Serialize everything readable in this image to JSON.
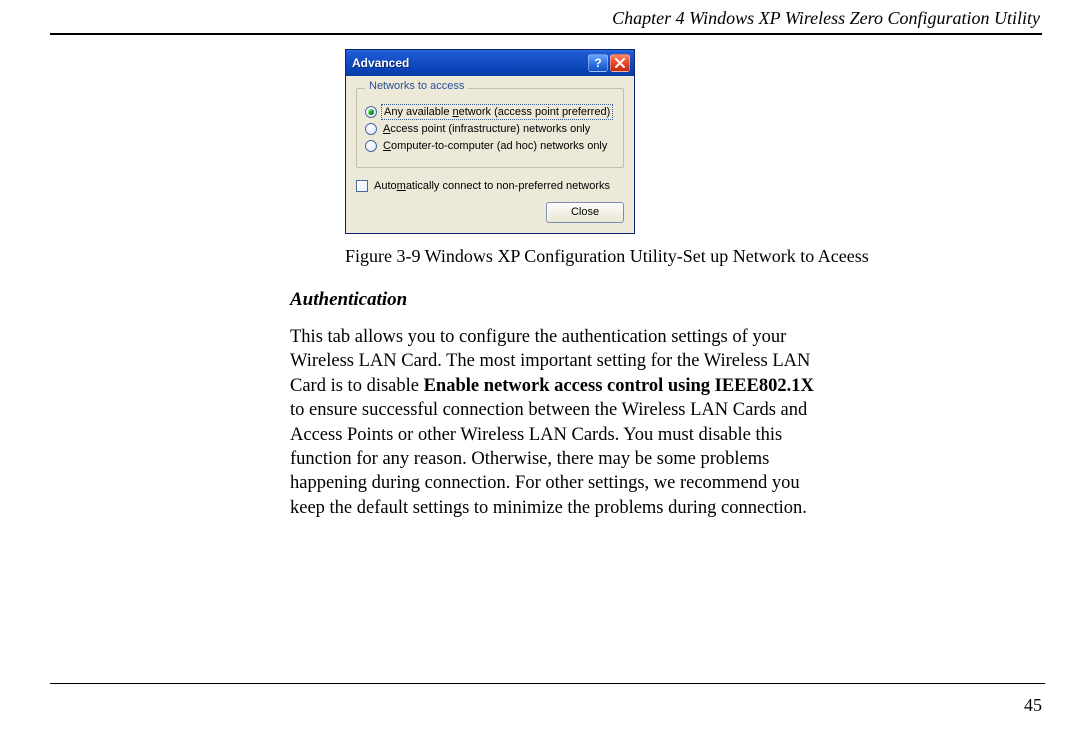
{
  "header": {
    "running_head": "Chapter 4   Windows XP Wireless Zero Configuration Utility"
  },
  "dialog": {
    "title": "Advanced",
    "group_label": "Networks to access",
    "options": {
      "any": {
        "pre": "Any available ",
        "key": "n",
        "post": "etwork (access point preferred)"
      },
      "ap": {
        "pre": "",
        "key": "A",
        "post": "ccess point (infrastructure) networks only"
      },
      "adhoc": {
        "pre": "",
        "key": "C",
        "post": "omputer-to-computer (ad hoc) networks only"
      }
    },
    "auto_connect": {
      "pre": "Auto",
      "key": "m",
      "post": "atically connect to non-preferred networks"
    },
    "close_label": "Close"
  },
  "caption": "Figure 3-9   Windows XP Configuration Utility-Set up Network to Aceess",
  "section_heading": "Authentication",
  "para_1a": "This tab allows you to configure the authentication settings of your Wireless LAN Card. The most important setting for the Wireless LAN Card is to disable ",
  "para_1_bold": "Enable network access control using IEEE802.1X",
  "para_1b": " to ensure successful connection between the Wireless LAN Cards and Access Points or other Wireless LAN Cards. You must disable this function for any reason. Otherwise, there may be some problems happening during connection. For other settings, we recommend you keep the default settings to minimize the problems during connection.",
  "page_number": "45"
}
